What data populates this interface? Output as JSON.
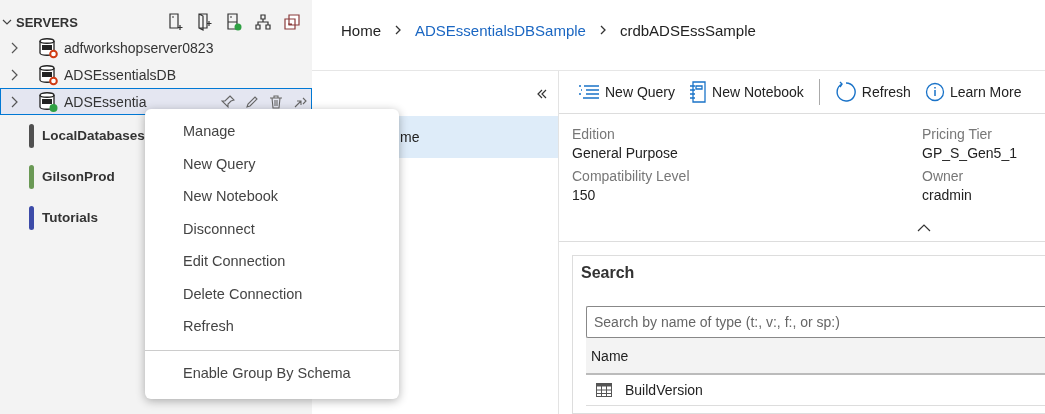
{
  "sidebar": {
    "title": "SERVERS",
    "servers": [
      {
        "name": "adfworkshopserver0823",
        "connected": false,
        "selected": false,
        "expanded": false
      },
      {
        "name": "ADSEssentialsDB",
        "connected": false,
        "selected": false,
        "expanded": false
      },
      {
        "name": "ADSEssentia",
        "connected": true,
        "selected": true,
        "expanded": false
      }
    ],
    "groups": [
      {
        "name": "LocalDatabases",
        "color": "#505050"
      },
      {
        "name": "GilsonProd",
        "color": "#6a9955"
      },
      {
        "name": "Tutorials",
        "color": "#3c4ba8"
      }
    ]
  },
  "context_menu": {
    "items": [
      "Manage",
      "New Query",
      "New Notebook",
      "Disconnect",
      "Edit Connection",
      "Delete Connection",
      "Refresh"
    ],
    "extra_items": [
      "Enable Group By Schema"
    ]
  },
  "breadcrumb": [
    {
      "label": "Home",
      "kind": "text"
    },
    {
      "label": "ADSEssentialsDBSample",
      "kind": "link"
    },
    {
      "label": "crdbADSEssSample",
      "kind": "text"
    }
  ],
  "nav": {
    "items": [
      {
        "label": "me",
        "selected": true
      }
    ]
  },
  "toolbar": [
    {
      "label": "New Query",
      "kind": "query"
    },
    {
      "label": "New Notebook",
      "kind": "notebook"
    },
    {
      "label": "Refresh",
      "kind": "refresh"
    },
    {
      "label": "Learn More",
      "kind": "info"
    }
  ],
  "properties": [
    [
      {
        "label": "Edition",
        "value": "General Purpose"
      },
      {
        "label": "Compatibility Level",
        "value": "150"
      }
    ],
    [
      {
        "label": "Pricing Tier",
        "value": "GP_S_Gen5_1"
      },
      {
        "label": "Owner",
        "value": "cradmin"
      }
    ]
  ],
  "search": {
    "title": "Search",
    "placeholder": "Search by name of type (t:, v:, f:, or sp:)",
    "column": "Name",
    "rows": [
      "BuildVersion"
    ]
  }
}
